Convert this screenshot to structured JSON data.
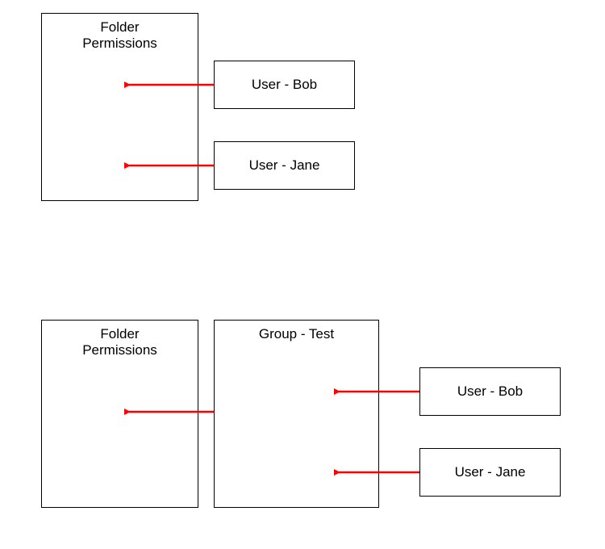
{
  "colors": {
    "arrow": "#ff0000",
    "border": "#000000"
  },
  "diagram1": {
    "folder_label_line1": "Folder",
    "folder_label_line2": "Permissions",
    "user1": "User - Bob",
    "user2": "User - Jane"
  },
  "diagram2": {
    "folder_label_line1": "Folder",
    "folder_label_line2": "Permissions",
    "group_label": "Group - Test",
    "user1": "User - Bob",
    "user2": "User - Jane"
  }
}
